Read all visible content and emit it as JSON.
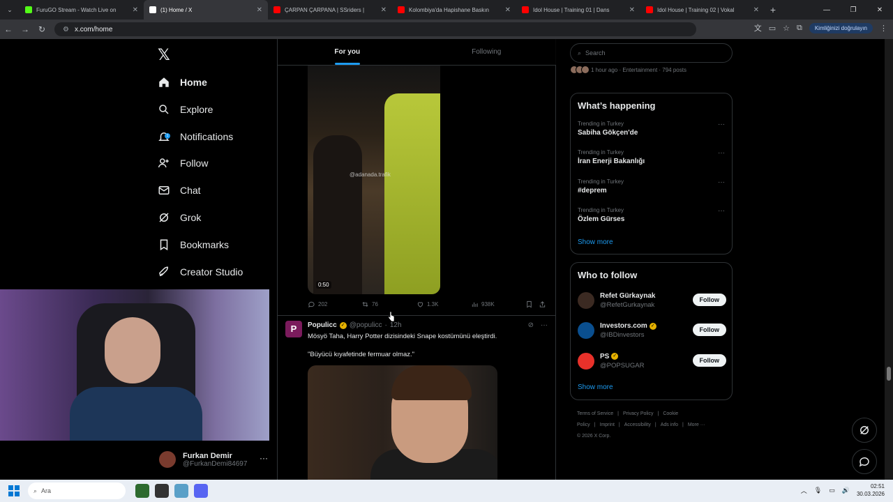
{
  "browser": {
    "tabs": [
      {
        "label": "FuruGO Stream - Watch Live on",
        "color": "#53fc18",
        "active": false
      },
      {
        "label": "(1) Home / X",
        "color": "#ffffff",
        "active": true
      },
      {
        "label": "ÇARPAN ÇARPANA | SSriders |",
        "color": "#ff0000",
        "active": false
      },
      {
        "label": "Kolombiya'da Hapishane Baskın",
        "color": "#ff0000",
        "active": false
      },
      {
        "label": "Idol House | Training 01 | Dans",
        "color": "#ff0000",
        "active": false
      },
      {
        "label": "Idol House | Training 02 | Vokal",
        "color": "#ff0000",
        "active": false
      }
    ],
    "url": "x.com/home",
    "verify_label": "Kimliğinizi doğrulayın"
  },
  "nav": {
    "items": [
      {
        "label": "Home",
        "icon": "home-icon"
      },
      {
        "label": "Explore",
        "icon": "search-icon"
      },
      {
        "label": "Notifications",
        "icon": "bell-icon"
      },
      {
        "label": "Follow",
        "icon": "person-add-icon"
      },
      {
        "label": "Chat",
        "icon": "mail-icon"
      },
      {
        "label": "Grok",
        "icon": "grok-icon"
      },
      {
        "label": "Bookmarks",
        "icon": "bookmark-icon"
      },
      {
        "label": "Creator Studio",
        "icon": "rocket-icon"
      }
    ],
    "notification_badge": "1"
  },
  "profile": {
    "name": "Furkan Demir",
    "handle": "@FurkanDemi84697"
  },
  "feed": {
    "tabs": [
      "For you",
      "Following"
    ],
    "post1": {
      "watermark": "@adanada.trafik",
      "duration": "0:50",
      "replies": "202",
      "reposts": "76",
      "likes": "1.3K",
      "views": "938K"
    },
    "post2": {
      "avatar_letter": "P",
      "name": "Populicc",
      "handle": "@populicc",
      "time": "12h",
      "line1": "Mösyö Taha, Harry Potter dizisindeki Snape kostümünü eleştirdi.",
      "line2": "\"Büyücü kıyafetinde fermuar olmaz.\""
    }
  },
  "sidebar": {
    "search_placeholder": "Search",
    "live_meta": "1 hour ago · Entertainment · 794 posts",
    "happening": {
      "title": "What’s happening",
      "trends": [
        {
          "category": "Trending in Turkey",
          "name": "Sabiha Gökçen'de"
        },
        {
          "category": "Trending in Turkey",
          "name": "İran Enerji Bakanlığı"
        },
        {
          "category": "Trending in Turkey",
          "name": "#deprem"
        },
        {
          "category": "Trending in Turkey",
          "name": "Özlem Gürses"
        }
      ],
      "show_more": "Show more"
    },
    "who_to_follow": {
      "title": "Who to follow",
      "accounts": [
        {
          "name": "Refet Gürkaynak",
          "handle": "@RefetGurkaynak",
          "verified": false,
          "avatar_color": "#3b2a22"
        },
        {
          "name": "Investors.com",
          "handle": "@IBDinvestors",
          "verified": true,
          "avatar_color": "#0a4f8f"
        },
        {
          "name": "PS",
          "handle": "@POPSUGAR",
          "verified": true,
          "avatar_color": "#e8312a"
        }
      ],
      "follow_label": "Follow",
      "show_more": "Show more"
    },
    "footer": {
      "links": [
        "Terms of Service",
        "|",
        "Privacy Policy",
        "|",
        "Cookie Policy",
        "|",
        "Imprint",
        "|",
        "Accessibility",
        "|",
        "Ads info",
        "|",
        "More ···"
      ],
      "copyright": "© 2026 X Corp."
    }
  },
  "taskbar": {
    "search_placeholder": "Ara",
    "time": "02:51",
    "date": "30.03.2026"
  }
}
